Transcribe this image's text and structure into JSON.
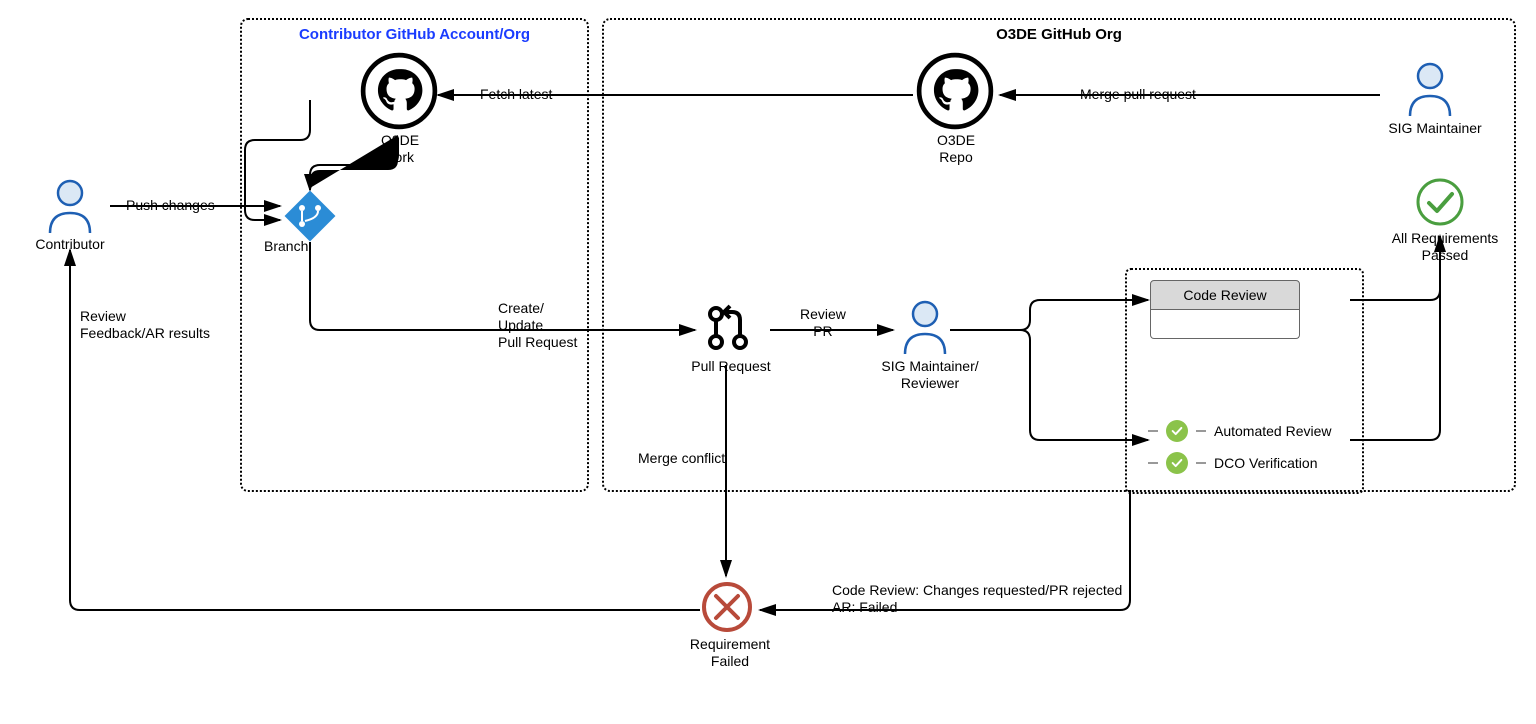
{
  "containers": {
    "contributor": "Contributor GitHub Account/Org",
    "o3de": "O3DE GitHub Org"
  },
  "nodes": {
    "contributor": "Contributor",
    "fork": "O3DE\nFork",
    "branch": "Branch",
    "repo": "O3DE\nRepo",
    "sigMaintainer": "SIG Maintainer",
    "pullRequest": "Pull Request",
    "sigReviewer": "SIG Maintainer/\nReviewer",
    "codeReview": "Code Review",
    "allPassed": "All Requirements\nPassed",
    "automatedReview": "Automated Review",
    "dcoVerification": "DCO Verification",
    "requirementFailed": "Requirement\nFailed"
  },
  "edges": {
    "pushChanges": "Push changes",
    "fetchLatest": "Fetch latest",
    "mergePR": "Merge pull request",
    "createUpdatePR": "Create/\nUpdate\nPull Request",
    "reviewPR": "Review\nPR",
    "mergeConflict": "Merge conflict",
    "failReason": "Code Review: Changes requested/PR rejected\nAR: Failed",
    "feedback": "Review\nFeedback/AR results"
  }
}
